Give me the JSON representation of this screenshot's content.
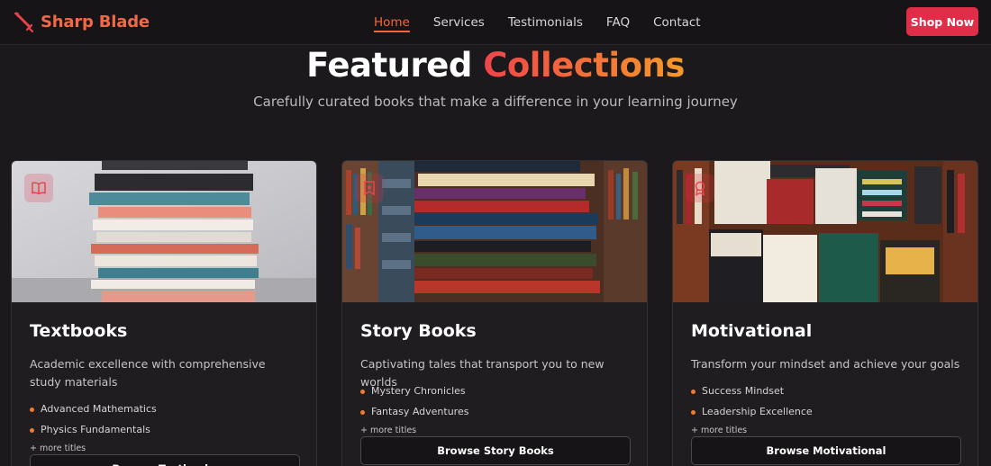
{
  "brand": {
    "name": "Sharp Blade",
    "icon": "sword-icon",
    "color": "#f06a46"
  },
  "nav": {
    "items": [
      {
        "label": "Home",
        "active": true
      },
      {
        "label": "Services",
        "active": false
      },
      {
        "label": "Testimonials",
        "active": false
      },
      {
        "label": "FAQ",
        "active": false
      },
      {
        "label": "Contact",
        "active": false
      }
    ],
    "cta": "Shop Now",
    "cta_color": "#e02e48"
  },
  "section": {
    "title_main": "Featured",
    "title_accent": "Collections",
    "subtitle": "Carefully curated books that make a difference in your learning journey"
  },
  "cards": [
    {
      "icon": "open-book-icon",
      "title": "Textbooks",
      "description": "Academic excellence with comprehensive study materials",
      "items": [
        "Advanced Mathematics",
        "Physics Fundamentals"
      ],
      "more": "+ more titles",
      "button": "Browse Textbooks"
    },
    {
      "icon": "bookmark-star-icon",
      "title": "Story Books",
      "description": "Captivating tales that transport you to new worlds",
      "items": [
        "Mystery Chronicles",
        "Fantasy Adventures"
      ],
      "more": "+ more titles",
      "button": "Browse Story Books"
    },
    {
      "icon": "award-ribbon-icon",
      "title": "Motivational",
      "description": "Transform your mindset and achieve your goals",
      "items": [
        "Success Mindset",
        "Leadership Excellence"
      ],
      "more": "+ more titles",
      "button": "Browse Motivational"
    }
  ],
  "colors": {
    "accent_start": "#f0444a",
    "accent_end": "#f59a2a",
    "background": "#1b191b",
    "bullet": "#f27a2e"
  }
}
